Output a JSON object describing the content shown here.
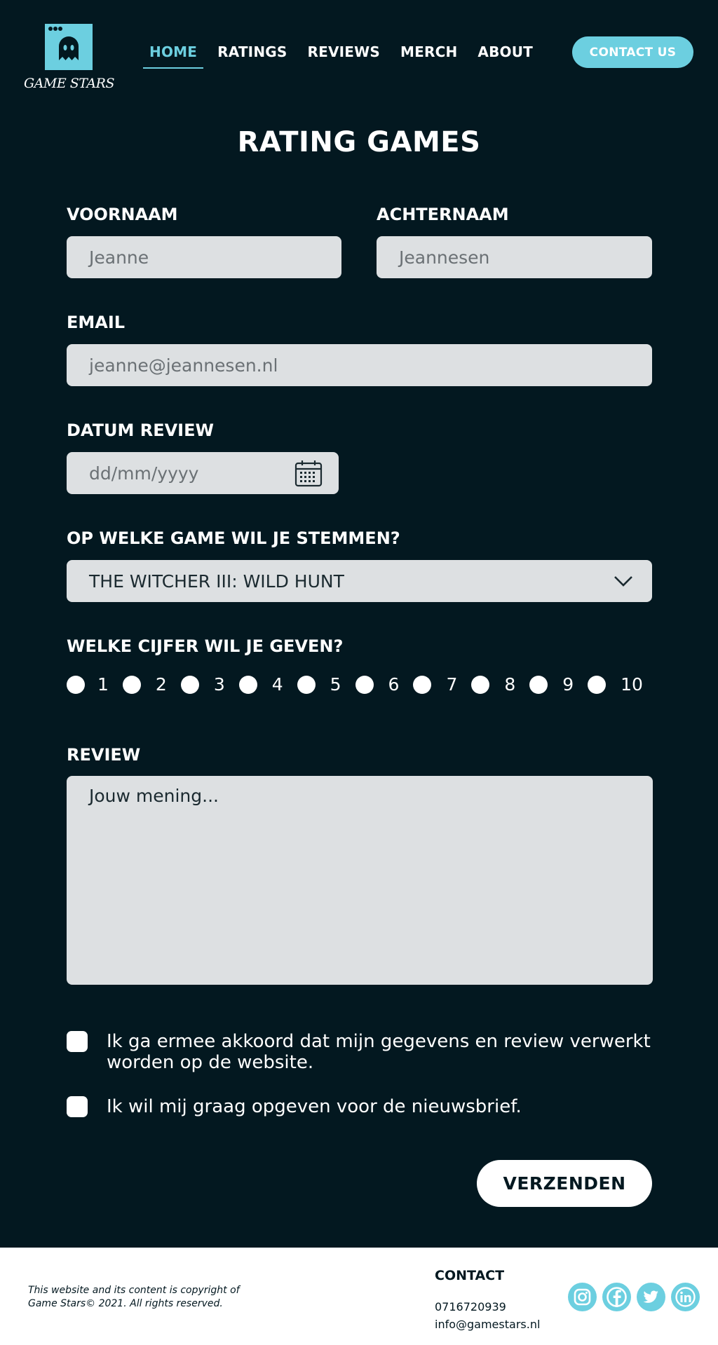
{
  "brand": {
    "name": "GAME STARS",
    "accent": "#6ccfe0",
    "background": "#031820"
  },
  "nav": {
    "items": [
      {
        "label": "HOME",
        "active": true
      },
      {
        "label": "RATINGS",
        "active": false
      },
      {
        "label": "REVIEWS",
        "active": false
      },
      {
        "label": "MERCH",
        "active": false
      },
      {
        "label": "ABOUT",
        "active": false
      }
    ],
    "contact_button": "CONTACT US"
  },
  "page_title": "RATING GAMES",
  "form": {
    "first_name": {
      "label": "VOORNAAM",
      "placeholder": "Jeanne"
    },
    "last_name": {
      "label": "ACHTERNAAM",
      "placeholder": "Jeannesen"
    },
    "email": {
      "label": "EMAIL",
      "placeholder": "jeanne@jeannesen.nl"
    },
    "date": {
      "label": "DATUM REVIEW",
      "placeholder": "dd/mm/yyyy",
      "icon": "calendar-icon"
    },
    "game": {
      "label": "OP WELKE GAME WIL JE STEMMEN?",
      "selected": "THE WITCHER III: WILD HUNT",
      "icon": "chevron-down-icon"
    },
    "rating": {
      "label": "WELKE CIJFER WIL JE GEVEN?",
      "options": [
        "1",
        "2",
        "3",
        "4",
        "5",
        "6",
        "7",
        "8",
        "9",
        "10"
      ]
    },
    "review": {
      "label": "REVIEW",
      "placeholder": "Jouw mening..."
    },
    "consent": {
      "label": "Ik ga ermee akkoord dat mijn gegevens en review verwerkt worden op de website.",
      "checked": false
    },
    "newsletter": {
      "label": "Ik wil mij graag opgeven voor de nieuwsbrief.",
      "checked": false
    },
    "submit": "VERZENDEN"
  },
  "footer": {
    "copyright_line1": "This website and its content is copyright of",
    "copyright_line2": "Game Stars© 2021. All rights reserved.",
    "contact_heading": "CONTACT",
    "phone": "0716720939",
    "email": "info@gamestars.nl",
    "social": [
      "instagram-icon",
      "facebook-icon",
      "twitter-icon",
      "linkedin-icon"
    ]
  }
}
